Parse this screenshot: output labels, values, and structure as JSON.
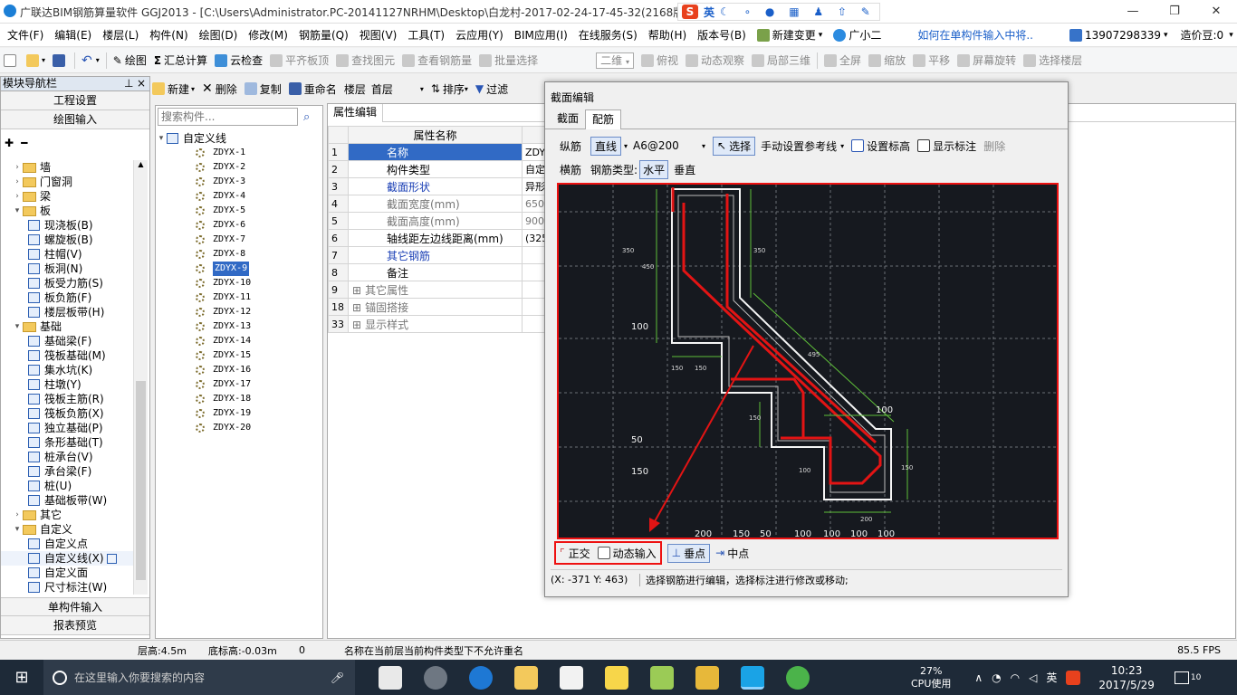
{
  "window": {
    "title": "广联达BIM钢筋算量软件 GGJ2013 - [C:\\Users\\Administrator.PC-20141127NRHM\\Desktop\\白龙村-2017-02-24-17-45-32(2168版",
    "ime_label": "英"
  },
  "menu": [
    "文件(F)",
    "编辑(E)",
    "楼层(L)",
    "构件(N)",
    "绘图(D)",
    "修改(M)",
    "钢筋量(Q)",
    "视图(V)",
    "工具(T)",
    "云应用(Y)",
    "BIM应用(I)",
    "在线服务(S)",
    "帮助(H)",
    "版本号(B)"
  ],
  "menu_right": {
    "new_change": "新建变更",
    "assistant": "广小二",
    "help_link": "如何在单构件输入中将..",
    "phone": "13907298339",
    "bean": "造价豆:0"
  },
  "toolbar": {
    "draw": "绘图",
    "sum": "汇总计算",
    "cloud": "云检查",
    "align": "平齐板顶",
    "find": "查找图元",
    "view_rebar": "查看钢筋量",
    "batch": "批量选择",
    "view2d": "二维",
    "top": "俯视",
    "dynamic": "动态观察",
    "local3d": "局部三维",
    "full": "全屏",
    "zoom": "缩放",
    "pan": "平移",
    "rotate": "屏幕旋转",
    "floor": "选择楼层"
  },
  "nav": {
    "title": "模块导航栏",
    "project": "工程设置",
    "draw_input": "绘图输入",
    "single_input": "单构件输入",
    "report": "报表预览",
    "tree": [
      {
        "t": "墙",
        "lvl": 0,
        "folder": true,
        "open": false
      },
      {
        "t": "门窗洞",
        "lvl": 0,
        "folder": true,
        "open": false
      },
      {
        "t": "梁",
        "lvl": 0,
        "folder": true,
        "open": false
      },
      {
        "t": "板",
        "lvl": 0,
        "folder": true,
        "open": true
      },
      {
        "t": "现浇板(B)",
        "lvl": 1
      },
      {
        "t": "螺旋板(B)",
        "lvl": 1
      },
      {
        "t": "柱帽(V)",
        "lvl": 1
      },
      {
        "t": "板洞(N)",
        "lvl": 1
      },
      {
        "t": "板受力筋(S)",
        "lvl": 1
      },
      {
        "t": "板负筋(F)",
        "lvl": 1
      },
      {
        "t": "楼层板带(H)",
        "lvl": 1
      },
      {
        "t": "基础",
        "lvl": 0,
        "folder": true,
        "open": true
      },
      {
        "t": "基础梁(F)",
        "lvl": 1
      },
      {
        "t": "筏板基础(M)",
        "lvl": 1
      },
      {
        "t": "集水坑(K)",
        "lvl": 1
      },
      {
        "t": "柱墩(Y)",
        "lvl": 1
      },
      {
        "t": "筏板主筋(R)",
        "lvl": 1
      },
      {
        "t": "筏板负筋(X)",
        "lvl": 1
      },
      {
        "t": "独立基础(P)",
        "lvl": 1
      },
      {
        "t": "条形基础(T)",
        "lvl": 1
      },
      {
        "t": "桩承台(V)",
        "lvl": 1
      },
      {
        "t": "承台梁(F)",
        "lvl": 1
      },
      {
        "t": "桩(U)",
        "lvl": 1
      },
      {
        "t": "基础板带(W)",
        "lvl": 1
      },
      {
        "t": "其它",
        "lvl": 0,
        "folder": true,
        "open": false
      },
      {
        "t": "自定义",
        "lvl": 0,
        "folder": true,
        "open": true
      },
      {
        "t": "自定义点",
        "lvl": 1
      },
      {
        "t": "自定义线(X)",
        "lvl": 1,
        "sel": true
      },
      {
        "t": "自定义面",
        "lvl": 1
      },
      {
        "t": "尺寸标注(W)",
        "lvl": 1
      }
    ]
  },
  "list": {
    "new": "新建",
    "delete": "删除",
    "copy": "复制",
    "rename": "重命名",
    "floor_label": "楼层",
    "floor_value": "首层",
    "sort": "排序",
    "filter": "过滤",
    "search_placeholder": "搜索构件...",
    "root": "自定义线",
    "items": [
      "ZDYX-1",
      "ZDYX-2",
      "ZDYX-3",
      "ZDYX-4",
      "ZDYX-5",
      "ZDYX-6",
      "ZDYX-7",
      "ZDYX-8",
      "ZDYX-9",
      "ZDYX-10",
      "ZDYX-11",
      "ZDYX-12",
      "ZDYX-13",
      "ZDYX-14",
      "ZDYX-15",
      "ZDYX-16",
      "ZDYX-17",
      "ZDYX-18",
      "ZDYX-19",
      "ZDYX-20"
    ],
    "selected": 8
  },
  "props": {
    "tab": "属性编辑",
    "header": "属性名称",
    "rows": [
      {
        "n": "1",
        "name": "名称",
        "val": "ZDYX",
        "sel": true,
        "blue": true
      },
      {
        "n": "2",
        "name": "构件类型",
        "val": "自定"
      },
      {
        "n": "3",
        "name": "截面形状",
        "val": "异形",
        "blue": true
      },
      {
        "n": "4",
        "name": "截面宽度(mm)",
        "val": "650",
        "gray": true
      },
      {
        "n": "5",
        "name": "截面高度(mm)",
        "val": "900",
        "gray": true
      },
      {
        "n": "6",
        "name": "轴线距左边线距离(mm)",
        "val": "(325"
      },
      {
        "n": "7",
        "name": "其它钢筋",
        "val": "",
        "blue": true
      },
      {
        "n": "8",
        "name": "备注",
        "val": ""
      },
      {
        "n": "9",
        "name": "其它属性",
        "val": "",
        "plus": true,
        "gray": true
      },
      {
        "n": "18",
        "name": "锚固搭接",
        "val": "",
        "plus": true,
        "gray": true
      },
      {
        "n": "33",
        "name": "显示样式",
        "val": "",
        "plus": true,
        "gray": true
      }
    ]
  },
  "dialog": {
    "title": "截面编辑",
    "tab_section": "截面",
    "tab_rebar": "配筋",
    "long_rebar": "纵筋",
    "line": "直线",
    "spec": "A6@200",
    "select": "选择",
    "manual_ref": "手动设置参考线",
    "set_dim": "设置标高",
    "show_dim": "显示标注",
    "delete": "删除",
    "trans_rebar": "横筋",
    "rebar_type_label": "钢筋类型:",
    "horizontal": "水平",
    "vertical": "垂直",
    "ortho": "正交",
    "dynamic_input": "动态输入",
    "perp": "垂点",
    "mid": "中点",
    "coords": "(X: -371 Y: 463)",
    "hint": "选择钢筋进行编辑，选择标注进行修改或移动;",
    "dims": [
      "350",
      "450",
      "350",
      "495",
      "100",
      "100",
      "150",
      "150",
      "150",
      "100",
      "50",
      "150",
      "150",
      "200",
      "200",
      "150",
      "50",
      "100",
      "100",
      "100",
      "100"
    ]
  },
  "status": {
    "floor_h": "层高:4.5m",
    "bottom_h": "底标高:-0.03m",
    "num": "0",
    "msg": "名称在当前层当前构件类型下不允许重名",
    "fps": "85.5 FPS"
  },
  "taskbar": {
    "search": "在这里输入你要搜索的内容",
    "cpu_pct": "27%",
    "cpu_label": "CPU使用",
    "ime": "英",
    "time": "10:23",
    "date": "2017/5/29",
    "notif": "10"
  },
  "colors": {
    "accent": "#316ac5",
    "highlight_red": "#e01010",
    "canvas_bg": "#16191f"
  }
}
